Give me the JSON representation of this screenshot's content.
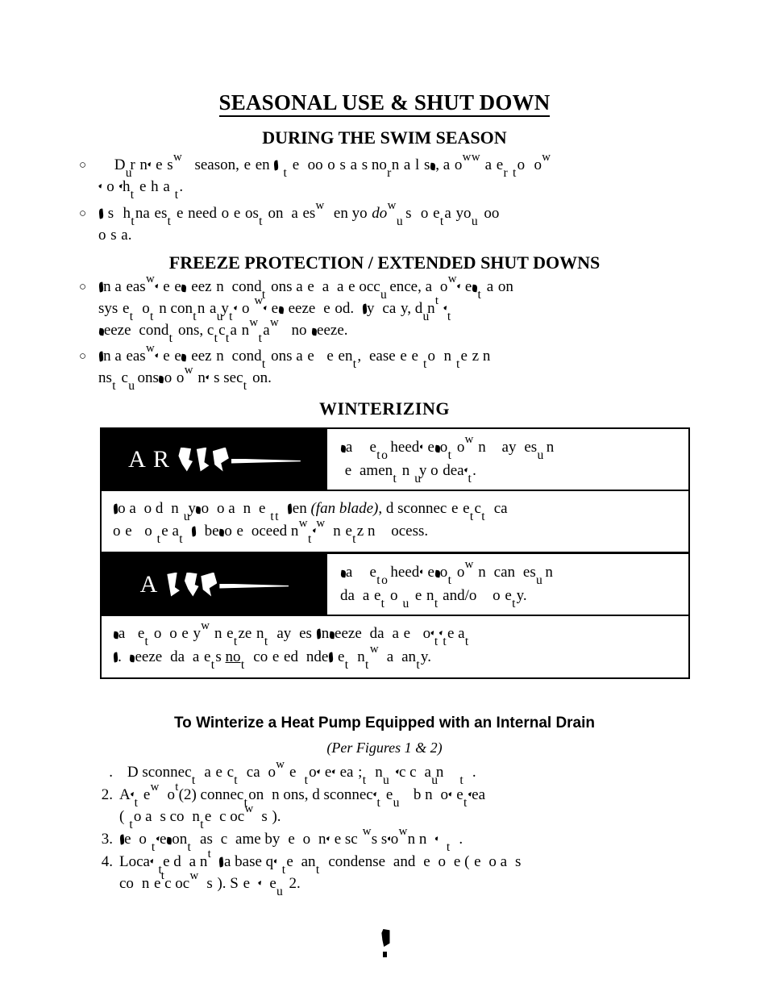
{
  "document": {
    "title": "SEASONAL USE & SHUT DOWN",
    "page_number_note": "corrupted glyph",
    "render_note": "body text glyphs partially dropped / displaced by broken font embedding"
  },
  "sections": {
    "swim_season": {
      "heading": "DURING THE SWIM SEASON",
      "bullets": [
        {
          "marker": "○",
          "lines": [
            "During the swim season, when the pool is at a normal use, allow water to flow",
            "to the heater."
          ]
        },
        {
          "marker": "○",
          "lines": [
            "Use thermostats if needed to restore on a test when you do wish to stay your pool",
            "or spa."
          ]
        }
      ]
    },
    "freeze_protection": {
      "heading": "FREEZE PROTECTION / EXTENDED SHUT DOWNS",
      "bullets": [
        {
          "marker": "○",
          "lines": [
            "In areas where freezing conditions are a rare occurrence, allow the filtration",
            "system to run continuously throughout the freeze period. My city, during the",
            "freeze conditions, check that water will not freeze."
          ]
        },
        {
          "marker": "○",
          "lines": [
            "In areas where freezing conditions are frequent, please refer to the winterizing",
            "instructions found in this section."
          ]
        }
      ]
    },
    "winterizing": {
      "heading": "WINTERIZING"
    }
  },
  "warning_boxes": [
    {
      "banner_label": "WARNING",
      "banner_render": "A R N N",
      "head_lines": [
        "Failure to heed the following may result in",
        "permanent injury or death."
      ],
      "body_lines": [
        "To avoid damage by foreign objects in the fan (fan blade), disconnect electrical",
        "power to the heater before proceeding with the winterizing process."
      ],
      "italic_terms": [
        "fan blade"
      ]
    },
    {
      "banner_label": "CAUTION",
      "banner_render": "A L M N",
      "head_lines": [
        "Failure to heed the following caution can result in",
        "damage to the equipment and/or property."
      ],
      "body_lines": [
        "Failure to properly winterize may result in freeze damage to the heater",
        "exchanger. Freeze damage is not covered under the equipment warranty."
      ],
      "underlined_terms": [
        "no"
      ]
    }
  ],
  "procedure": {
    "heading": "To Winterize a Heat Pump Equipped with an Internal Drain",
    "subheading": "(Per Figures 1 & 2)",
    "steps": [
      {
        "number": "1.",
        "number_render": ".",
        "lines": [
          "Disconnect all electrical power to the heater; turn off circuit breaker."
        ]
      },
      {
        "number": "2.",
        "number_render": "2.",
        "lines": [
          "At the two (2) connection unions, disconnect the heater from the water",
          "(filter to always connect cock valve)."
        ]
      },
      {
        "number": "3.",
        "number_render": "3.",
        "lines": [
          "Remove the front access cover by removing the screws surrounding it."
        ]
      },
      {
        "number": "4.",
        "number_render": "4.",
        "lines": [
          "Locate the drain at the base of the unit condenser and remove (this is also",
          "connect cock valve). See Figure 2."
        ]
      }
    ]
  }
}
